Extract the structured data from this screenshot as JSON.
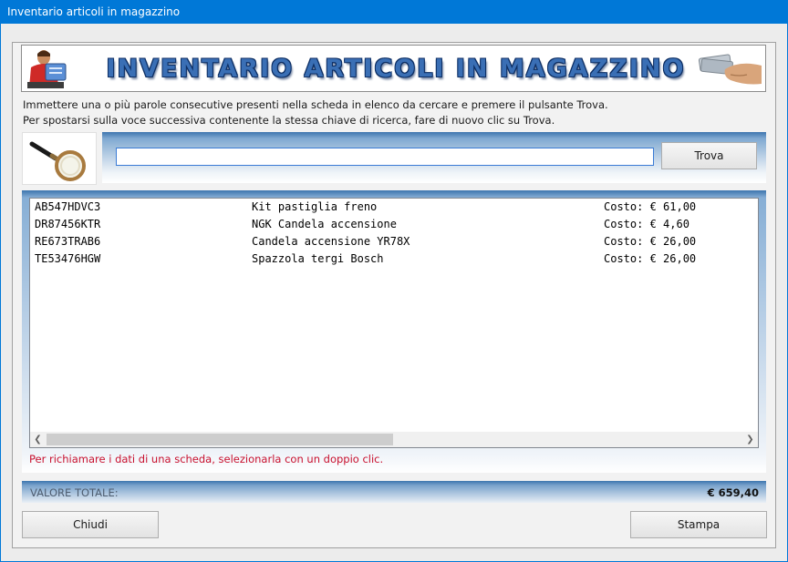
{
  "window": {
    "title": "Inventario articoli in magazzino"
  },
  "banner": {
    "title": "INVENTARIO ARTICOLI IN MAGAZZINO"
  },
  "instructions": {
    "line1": "Immettere una o più parole consecutive presenti nella scheda in elenco da cercare e premere il pulsante Trova.",
    "line2": "Per spostarsi sulla voce successiva contenente la stessa chiave di ricerca, fare di nuovo clic su Trova."
  },
  "search": {
    "value": "",
    "button_label": "Trova"
  },
  "list": {
    "rows": [
      {
        "code": "AB547HDVC3",
        "description": "Kit pastiglia freno",
        "cost": "Costo: € 61,00"
      },
      {
        "code": "DR87456KTR",
        "description": "NGK Candela accensione",
        "cost": "Costo: € 4,60"
      },
      {
        "code": "RE673TRAB6",
        "description": "Candela accensione YR78X",
        "cost": "Costo: € 26,00"
      },
      {
        "code": "TE53476HGW",
        "description": "Spazzola tergi Bosch",
        "cost": "Costo: € 26,00"
      }
    ],
    "hint": "Per richiamare i dati di una scheda, selezionarla con un doppio clic."
  },
  "total": {
    "label": "VALORE TOTALE:",
    "value": "€ 659,40"
  },
  "buttons": {
    "close_label": "Chiudi",
    "print_label": "Stampa"
  },
  "colors": {
    "accent": "#0078d7",
    "panel_blue": "#3d75ae",
    "hint_red": "#c8102e"
  },
  "icons": {
    "search": "magnifying-glass-icon",
    "scroll_left": "chevron-left-icon",
    "scroll_right": "chevron-right-icon"
  }
}
